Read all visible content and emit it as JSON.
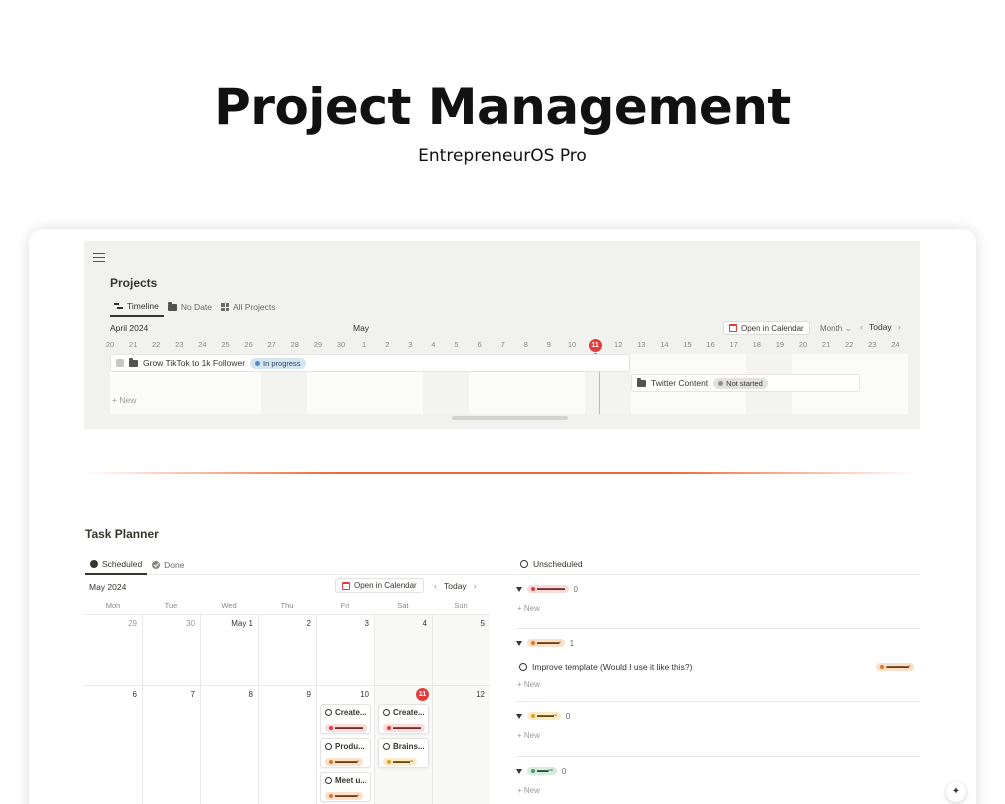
{
  "hero": {
    "title": "Project Management",
    "subtitle": "EntrepreneurOS Pro"
  },
  "projects": {
    "title": "Projects",
    "tabs": [
      {
        "label": "Timeline",
        "icon": "timeline-icon",
        "active": true
      },
      {
        "label": "No Date",
        "icon": "folder-icon",
        "active": false
      },
      {
        "label": "All Projects",
        "icon": "grid-icon",
        "active": false
      }
    ],
    "timeline": {
      "month_a": "April 2024",
      "month_b": "May",
      "open_calendar": "Open in Calendar",
      "range_select": "Month",
      "today": "Today",
      "days": [
        "20",
        "21",
        "22",
        "23",
        "24",
        "25",
        "26",
        "27",
        "28",
        "29",
        "30",
        "1",
        "2",
        "3",
        "4",
        "5",
        "6",
        "7",
        "8",
        "9",
        "10",
        "11",
        "12",
        "13",
        "14",
        "15",
        "16",
        "17",
        "18",
        "19",
        "20",
        "21",
        "22",
        "23",
        "24"
      ],
      "today_day": "11",
      "new_label": "New",
      "items": [
        {
          "name": "Grow TikTok to 1k Follower",
          "status": "In progress",
          "status_color": "#4b8ccf"
        },
        {
          "name": "Twitter Content",
          "status": "Not started",
          "status_color": "#91918e"
        }
      ]
    }
  },
  "task_planner": {
    "title": "Task Planner",
    "tabs": [
      {
        "label": "Scheduled",
        "active": true
      },
      {
        "label": "Done",
        "active": false
      }
    ],
    "calendar": {
      "month": "May 2024",
      "open_calendar": "Open in Calendar",
      "today": "Today",
      "weekdays": [
        "Mon",
        "Tue",
        "Wed",
        "Thu",
        "Fri",
        "Sat",
        "Sun"
      ],
      "week1": [
        "29",
        "30",
        "May 1",
        "2",
        "3",
        "4",
        "5"
      ],
      "week2": [
        "6",
        "7",
        "8",
        "9",
        "10",
        "11",
        "12"
      ],
      "today_date": "11",
      "cards": [
        {
          "title": "Create...",
          "priority": "▬▬▬▬▬",
          "color": "red"
        },
        {
          "title": "Produ...",
          "priority": "▬▬▬▬▫",
          "color": "orange"
        },
        {
          "title": "Meet u...",
          "priority": "▬▬▬▬▫",
          "color": "orange"
        },
        {
          "title": "Create...",
          "priority": "▬▬▬▬▬",
          "color": "red"
        },
        {
          "title": "Brains...",
          "priority": "▬▬▬▫▫",
          "color": "yellow"
        }
      ]
    },
    "unscheduled": {
      "label": "Unscheduled",
      "new_label": "New",
      "groups": [
        {
          "priority": "▬▬▬▬▬",
          "color": "red",
          "count": "0"
        },
        {
          "priority": "▬▬▬▬▫",
          "color": "orange",
          "count": "1"
        },
        {
          "priority": "▬▬▬▫▫",
          "color": "yellow",
          "count": "0"
        },
        {
          "priority": "▬▬▫▫▫",
          "color": "green",
          "count": "0"
        }
      ],
      "task": {
        "title": "Improve template (Would I use it like this?)",
        "priority": "▬▬▬▬▫"
      }
    }
  },
  "colors": {
    "accent_divider": "#ef6a34",
    "today": "#e03e3e"
  },
  "fab": {
    "icon": "sparkle-icon",
    "glyph": "✦"
  }
}
